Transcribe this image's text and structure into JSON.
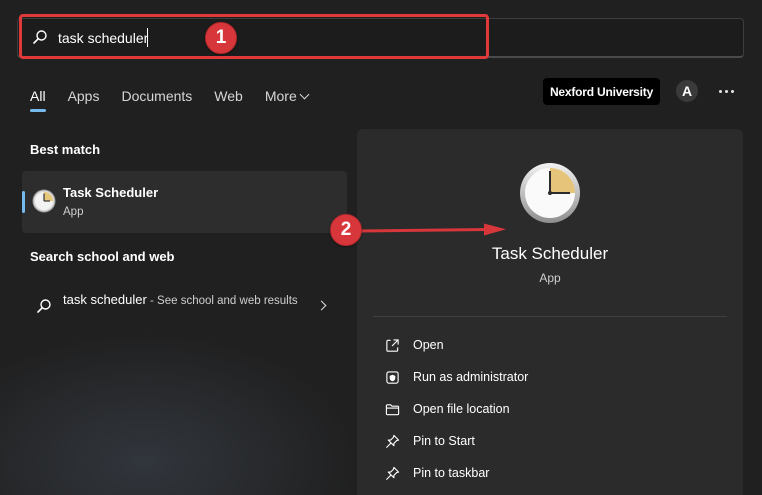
{
  "search": {
    "value": "task scheduler",
    "icon": "search-icon"
  },
  "annotations": {
    "step1": "1",
    "step2": "2",
    "highlight_color": "#e0393a"
  },
  "tabs": [
    {
      "label": "All",
      "active": true
    },
    {
      "label": "Apps"
    },
    {
      "label": "Documents"
    },
    {
      "label": "Web"
    },
    {
      "label": "More"
    }
  ],
  "header": {
    "org_name": "Nexford University",
    "avatar_initial": "A"
  },
  "best_match": {
    "title": "Best match",
    "item": {
      "name": "Task Scheduler",
      "type": "App"
    }
  },
  "school_web": {
    "title": "Search school and web",
    "item": {
      "query": "task scheduler",
      "suffix": " - See school and web results"
    }
  },
  "detail": {
    "name": "Task Scheduler",
    "type": "App",
    "actions": [
      {
        "label": "Open",
        "icon": "open-external-icon"
      },
      {
        "label": "Run as administrator",
        "icon": "shield-icon"
      },
      {
        "label": "Open file location",
        "icon": "folder-icon"
      },
      {
        "label": "Pin to Start",
        "icon": "pin-icon"
      },
      {
        "label": "Pin to taskbar",
        "icon": "pin-icon"
      }
    ]
  },
  "colors": {
    "accent": "#76b9ed",
    "background": "#202020",
    "panel": "#2b2b2b",
    "annotation": "#d7363a"
  }
}
